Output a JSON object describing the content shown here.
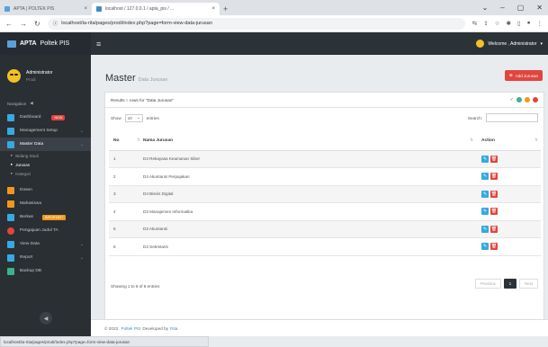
{
  "browser": {
    "tabs": [
      {
        "title": "APTA | POLTEK PIS",
        "favicon_color": "#5aa0d8"
      },
      {
        "title": "localhost / 127.0.0.1 / apta_pis / ...",
        "favicon_color": "#3c8dbc"
      }
    ],
    "new_tab": "+",
    "url": "localhost/ta-rita/pages/prodi/index.php?page=form-view-data-jurusan"
  },
  "topnav": {
    "brand_bold": "APTA",
    "brand_rest": "Poltek PIS",
    "welcome": "Welcome , Administrator"
  },
  "user": {
    "name": "Administrator",
    "role": "Prodi"
  },
  "sidebar": {
    "nav_label": "Navigation",
    "items": [
      {
        "label": "Dashboard",
        "badge": "NEW",
        "icon_color": "#37a9e1"
      },
      {
        "label": "Management Setup",
        "icon_color": "#37a9e1"
      },
      {
        "label": "Master Data",
        "icon_color": "#37a9e1"
      },
      {
        "label": "Dosen",
        "icon_color": "#f0981e"
      },
      {
        "label": "Mahasiswa",
        "icon_color": "#f0981e"
      },
      {
        "label": "Berkas",
        "badge": "IMPORTANT",
        "icon_color": "#37a9e1"
      },
      {
        "label": "Pengajuan Judul TA",
        "icon_color": "#e0463e"
      },
      {
        "label": "View Data",
        "icon_color": "#37a9e1"
      },
      {
        "label": "Report",
        "icon_color": "#37a9e1"
      },
      {
        "label": "Backup DB",
        "icon_color": "#3db28a"
      }
    ],
    "subitems": [
      "Bidang Studi",
      "Jurusan",
      "Kategori"
    ]
  },
  "page": {
    "title": "Master",
    "subtitle": "Data Jurusan",
    "add_button": "Add Jurusan"
  },
  "card": {
    "results_prefix": "Results",
    "results_count": "6",
    "results_suffix": "rows for \"Data Jurusan\"",
    "show_label": "Show",
    "show_value": "10",
    "entries_label": "entries",
    "search_label": "Search:"
  },
  "table": {
    "headers": {
      "no": "No",
      "nama": "Nama Jurusan",
      "action": "Action"
    },
    "rows": [
      {
        "no": "1",
        "nama": "D4 Rekayasa Keamanan Siber"
      },
      {
        "no": "2",
        "nama": "D4 Akuntansi Perpajakan"
      },
      {
        "no": "3",
        "nama": "D4 Bisnis Digital"
      },
      {
        "no": "4",
        "nama": "D3 Manajemen Informatika"
      },
      {
        "no": "5",
        "nama": "D3 Akuntansi"
      },
      {
        "no": "6",
        "nama": "D3 Sekretaris"
      }
    ]
  },
  "info": "Showing 1 to 6 of 6 entries",
  "pager": {
    "prev": "Previous",
    "current": "1",
    "next": "Next"
  },
  "footer": {
    "prefix": "© 2022.",
    "link1": "Poltek PIS",
    "middle": "Developed by",
    "link2": "Rita"
  },
  "status_url": "localhost/ta-rita/pages/prodi/index.php?page=form-view-data-jurusan",
  "colors": {
    "danger": "#e0463e",
    "info": "#37a9e1",
    "dark": "#2c3338",
    "accent": "#f3c220"
  }
}
